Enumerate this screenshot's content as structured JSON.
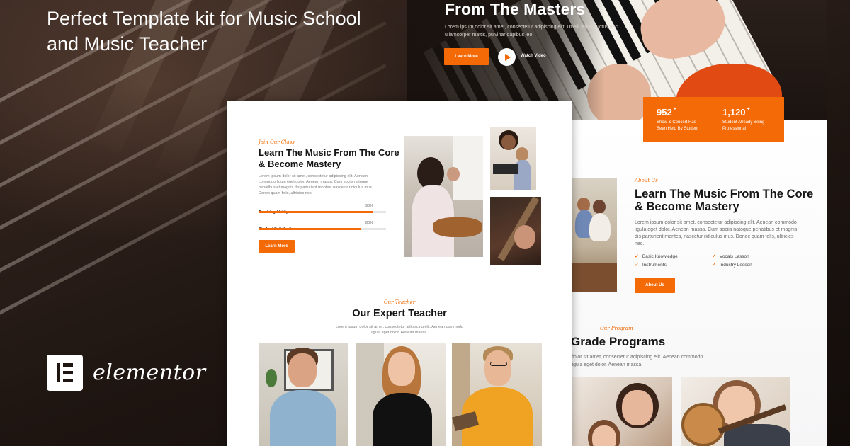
{
  "promo": {
    "headline": "Perfect Template kit for Music School and Music Teacher",
    "brand_name": "elementor"
  },
  "hero": {
    "title": "From The Masters",
    "description": "Lorem ipsum dolor sit amet, consectetur adipiscing elit. Ut elit tellus, luctus nec ullamcorper mattis, pulvinar dapibus leo.",
    "learn_more": "Learn More",
    "watch_video": "Watch Video"
  },
  "stats": [
    {
      "value": "952",
      "suffix": "+",
      "label": "Show & Concert Has Been Held By Student"
    },
    {
      "value": "1,120",
      "suffix": "+",
      "label": "Student Already Being Professional"
    }
  ],
  "about": {
    "tag": "About Us",
    "title": "Learn The Music From The Core & Become Mastery",
    "description": "Lorem ipsum dolor sit amet, consectetur adipiscing elit. Aenean commodo ligula eget dolor. Aenean massa. Cum sociis natoque penatibus et magnis dis parturient montes, nascetur ridiculus mus. Donec quam felis, ultricies nec.",
    "features": [
      "Basic Knowledge",
      "Vocals Lesson",
      "Instruments",
      "Industry Lesson"
    ],
    "button": "About Us"
  },
  "program": {
    "tag": "Our Program",
    "title": "Grade Programs",
    "description": "dolor sit amet, consectetur adipiscing elit. Aenean commodo ligula eget dolor. Aenean massa."
  },
  "join": {
    "tag": "Join Our Class",
    "title": "Learn The Music From The Core & Become Mastery",
    "description": "Lorem ipsum dolor sit amet, consectetur adipiscing elit. Aenean commodo ligula eget dolor. Aenean massa. Cum sociis natoque penatibus et magnis dis parturient montes, nascetur ridiculus mus. Donec quam felis, ultricies nec.",
    "bars": [
      {
        "label": "Teaching Ability",
        "percent_text": "90%",
        "value": 0.9
      },
      {
        "label": "Student Satisfaction",
        "percent_text": "80%",
        "value": 0.8
      }
    ],
    "button": "Learn More"
  },
  "teachers": {
    "tag": "Our Teacher",
    "title": "Our Expert Teacher",
    "description": "Lorem ipsum dolor sit amet, consectetur adipiscing elit. Aenean commodo ligula eget dolor. Aenean massa."
  },
  "colors": {
    "accent": "#f46a06",
    "dark": "#1f1612",
    "text": "#151515"
  }
}
